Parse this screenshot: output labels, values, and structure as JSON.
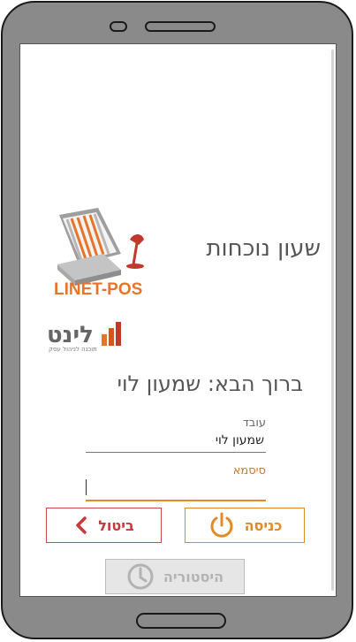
{
  "app": {
    "title": "שעון נוכחות"
  },
  "logos": {
    "pos": {
      "text": "LINET-POS"
    },
    "linet": {
      "text": "לינט",
      "tagline": "תוכנה לניהול עסק"
    }
  },
  "welcome": {
    "text": "ברוך הבא: שמעון לוי"
  },
  "form": {
    "employee_label": "עובד",
    "employee_value": "שמעון לוי",
    "password_label": "סיסמא",
    "password_value": ""
  },
  "buttons": {
    "enter_label": "כניסה",
    "cancel_label": "ביטול",
    "history_label": "היסטוריה"
  },
  "colors": {
    "accent": "#e08a2a",
    "danger": "#c23a3a",
    "disabled": "#b3b3b3"
  },
  "icons": {
    "enter": "power-icon",
    "cancel": "chevron-left-icon",
    "history": "clock-icon"
  }
}
